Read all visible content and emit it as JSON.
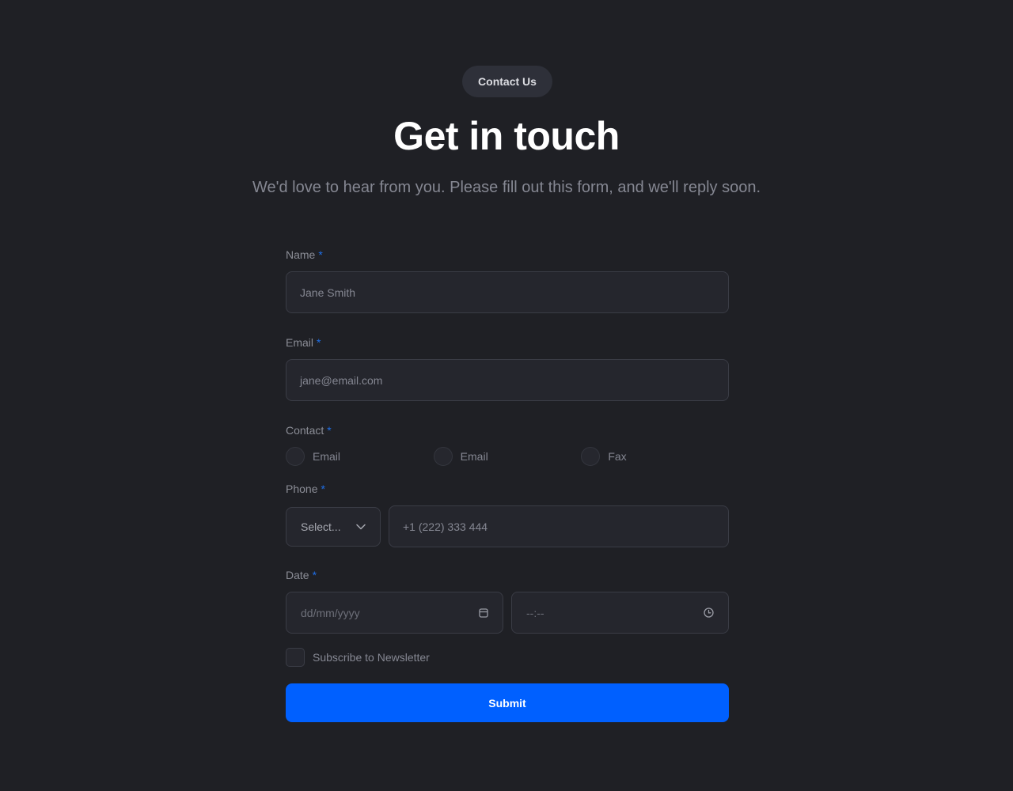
{
  "header": {
    "badge": "Contact Us",
    "title": "Get in touch",
    "subtitle": "We'd love to hear from you. Please fill out this form, and we'll reply soon."
  },
  "form": {
    "required_marker": "*",
    "name": {
      "label": "Name",
      "placeholder": "Jane Smith",
      "value": ""
    },
    "email": {
      "label": "Email",
      "placeholder": "jane@email.com",
      "value": ""
    },
    "contact": {
      "label": "Contact",
      "options": [
        {
          "label": "Email",
          "checked": false
        },
        {
          "label": "Email",
          "checked": false
        },
        {
          "label": "Fax",
          "checked": false
        }
      ]
    },
    "phone": {
      "label": "Phone",
      "country_select": {
        "selected": "Select...",
        "icon": "chevron-down-icon"
      },
      "placeholder": "+1 (222) 333 444",
      "value": ""
    },
    "date": {
      "label": "Date",
      "date_placeholder": "dd/mm/yyyy",
      "date_icon": "calendar-icon",
      "time_placeholder": "--:--",
      "time_icon": "clock-icon"
    },
    "newsletter": {
      "label": "Subscribe to Newsletter",
      "checked": false
    },
    "submit_label": "Submit"
  },
  "colors": {
    "background": "#1f2025",
    "accent": "#0060ff",
    "required": "#1f6fe8",
    "field_bg": "#25262d",
    "field_border": "#3a3c45"
  }
}
